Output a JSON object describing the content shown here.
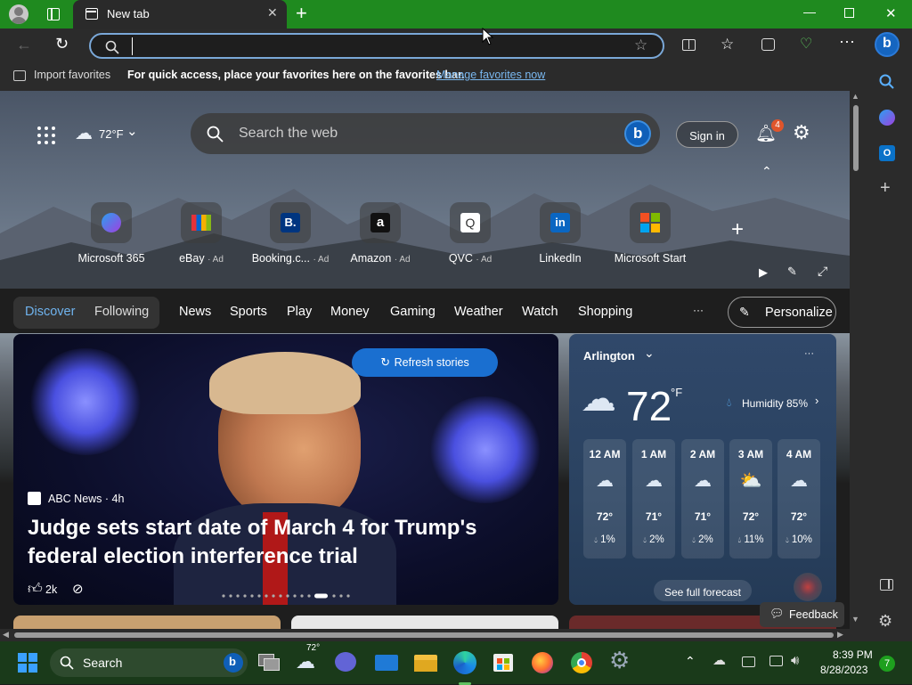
{
  "browser": {
    "tab_title": "New tab",
    "address_value": "",
    "favorites_bar": {
      "import_label": "Import favorites",
      "message": "For quick access, place your favorites here on the favorites bar.",
      "manage_link": "Manage favorites now"
    }
  },
  "newtab": {
    "weather_header": "72°F",
    "search_placeholder": "Search the web",
    "sign_in": "Sign in",
    "notification_count": "4",
    "quick_links": [
      {
        "label": "Microsoft 365",
        "ad": ""
      },
      {
        "label": "eBay",
        "ad": "· Ad"
      },
      {
        "label": "Booking.c...",
        "ad": "· Ad"
      },
      {
        "label": "Amazon",
        "ad": "· Ad"
      },
      {
        "label": "QVC",
        "ad": "· Ad"
      },
      {
        "label": "LinkedIn",
        "ad": ""
      },
      {
        "label": "Microsoft Start",
        "ad": ""
      }
    ],
    "nav": {
      "discover": "Discover",
      "following": "Following",
      "items": [
        "News",
        "Sports",
        "Play",
        "Money",
        "Gaming",
        "Weather",
        "Watch",
        "Shopping"
      ],
      "more": "···",
      "personalize": "Personalize"
    },
    "hero": {
      "refresh": "Refresh stories",
      "source": "ABC News · 4h",
      "headline": "Judge sets start date of March 4 for Trump's federal election interference trial",
      "likes": "2k"
    },
    "weather": {
      "city": "Arlington",
      "temp": "72",
      "unit": "°F",
      "humidity": "Humidity 85%",
      "hours": [
        {
          "time": "12 AM",
          "temp": "72°",
          "precip": "1%"
        },
        {
          "time": "1 AM",
          "temp": "71°",
          "precip": "2%"
        },
        {
          "time": "2 AM",
          "temp": "71°",
          "precip": "2%"
        },
        {
          "time": "3 AM",
          "temp": "72°",
          "precip": "11%"
        },
        {
          "time": "4 AM",
          "temp": "72°",
          "precip": "10%"
        }
      ],
      "see_full": "See full forecast"
    },
    "feedback": "Feedback"
  },
  "taskbar": {
    "search": "Search",
    "weather_temp": "72°",
    "time": "8:39 PM",
    "date": "8/28/2023",
    "notif": "7"
  },
  "colors": {
    "titlebar": "#1f8a1f",
    "accent": "#4fa3e0",
    "badge": "#e0552b"
  }
}
